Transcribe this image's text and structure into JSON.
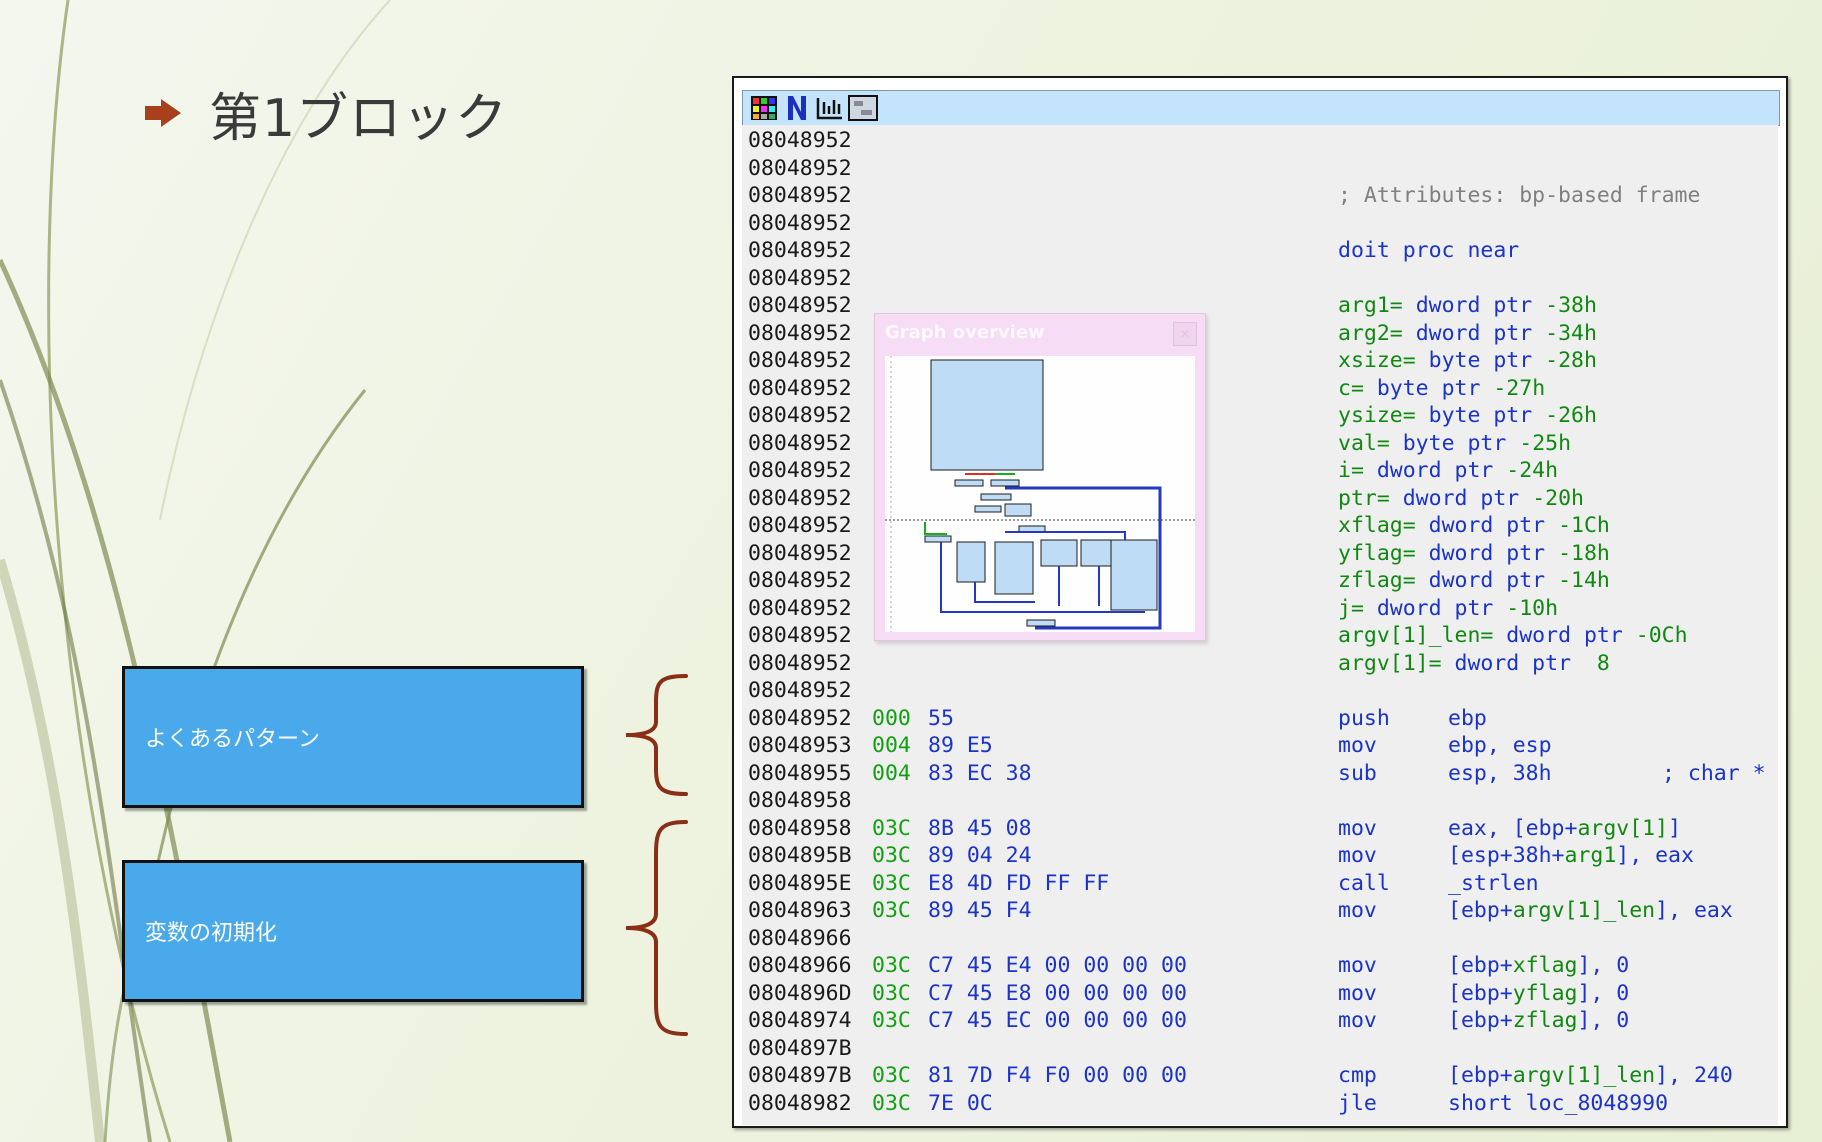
{
  "slide": {
    "title": "第1ブロック",
    "callouts": [
      {
        "label": "よくあるパターン"
      },
      {
        "label": "変数の初期化"
      }
    ]
  },
  "ida": {
    "toolbar_icons": [
      "graph-grid-icon",
      "names-n-icon",
      "strings-icon",
      "segments-icon"
    ],
    "graph_overview": {
      "title": "Graph overview"
    },
    "lines": [
      {
        "addr": "08048952"
      },
      {
        "addr": "08048952"
      },
      {
        "addr": "08048952",
        "comment": "; Attributes: bp-based frame"
      },
      {
        "addr": "08048952"
      },
      {
        "addr": "08048952",
        "proc": "doit proc near"
      },
      {
        "addr": "08048952"
      },
      {
        "addr": "08048952",
        "name": "arg1=",
        "type": "dword ptr",
        "off": "-38h"
      },
      {
        "addr": "08048952",
        "name": "arg2=",
        "type": "dword ptr",
        "off": "-34h"
      },
      {
        "addr": "08048952",
        "name": "xsize=",
        "type": "byte ptr",
        "off": "-28h"
      },
      {
        "addr": "08048952",
        "name": "c=",
        "type": "byte ptr",
        "off": "-27h"
      },
      {
        "addr": "08048952",
        "name": "ysize=",
        "type": "byte ptr",
        "off": "-26h"
      },
      {
        "addr": "08048952",
        "name": "val=",
        "type": "byte ptr",
        "off": "-25h"
      },
      {
        "addr": "08048952",
        "name": "i=",
        "type": "dword ptr",
        "off": "-24h"
      },
      {
        "addr": "08048952",
        "name": "ptr=",
        "type": "dword ptr",
        "off": "-20h"
      },
      {
        "addr": "08048952",
        "name": "xflag=",
        "type": "dword ptr",
        "off": "-1Ch"
      },
      {
        "addr": "08048952",
        "name": "yflag=",
        "type": "dword ptr",
        "off": "-18h"
      },
      {
        "addr": "08048952",
        "name": "zflag=",
        "type": "dword ptr",
        "off": "-14h"
      },
      {
        "addr": "08048952",
        "name": "j=",
        "type": "dword ptr",
        "off": "-10h"
      },
      {
        "addr": "08048952",
        "name": "argv[1]_len=",
        "type": "dword ptr",
        "off": "-0Ch"
      },
      {
        "addr": "08048952",
        "name": "argv[1]=",
        "type": "dword ptr",
        "off": " 8"
      },
      {
        "addr": "08048952"
      },
      {
        "addr": "08048952",
        "sp": "000",
        "bytes": "55",
        "mnem": "push",
        "ops": "ebp"
      },
      {
        "addr": "08048953",
        "sp": "004",
        "bytes": "89 E5",
        "mnem": "mov",
        "ops": "ebp, esp"
      },
      {
        "addr": "08048955",
        "sp": "004",
        "bytes": "83 EC 38",
        "mnem": "sub",
        "ops": "esp, 38h",
        "rcomment": "; char *"
      },
      {
        "addr": "08048958"
      },
      {
        "addr": "08048958",
        "sp": "03C",
        "bytes": "8B 45 08",
        "mnem": "mov",
        "ops_pre": "eax, [ebp+",
        "ops_var": "argv[1]",
        "ops_post": "]"
      },
      {
        "addr": "0804895B",
        "sp": "03C",
        "bytes": "89 04 24",
        "mnem": "mov",
        "ops_pre": "[esp+38h+",
        "ops_var": "arg1",
        "ops_post": "], eax"
      },
      {
        "addr": "0804895E",
        "sp": "03C",
        "bytes": "E8 4D FD FF FF",
        "mnem": "call",
        "ops": "_strlen"
      },
      {
        "addr": "08048963",
        "sp": "03C",
        "bytes": "89 45 F4",
        "mnem": "mov",
        "ops_pre": "[ebp+",
        "ops_var": "argv[1]_len",
        "ops_post": "], eax"
      },
      {
        "addr": "08048966"
      },
      {
        "addr": "08048966",
        "sp": "03C",
        "bytes": "C7 45 E4 00 00 00 00",
        "mnem": "mov",
        "ops_pre": "[ebp+",
        "ops_var": "xflag",
        "ops_post": "], 0"
      },
      {
        "addr": "0804896D",
        "sp": "03C",
        "bytes": "C7 45 E8 00 00 00 00",
        "mnem": "mov",
        "ops_pre": "[ebp+",
        "ops_var": "yflag",
        "ops_post": "], 0"
      },
      {
        "addr": "08048974",
        "sp": "03C",
        "bytes": "C7 45 EC 00 00 00 00",
        "mnem": "mov",
        "ops_pre": "[ebp+",
        "ops_var": "zflag",
        "ops_post": "], 0"
      },
      {
        "addr": "0804897B"
      },
      {
        "addr": "0804897B",
        "sp": "03C",
        "bytes": "81 7D F4 F0 00 00 00",
        "mnem": "cmp",
        "ops_pre": "[ebp+",
        "ops_var": "argv[1]_len",
        "ops_post": "], 240"
      },
      {
        "addr": "08048982",
        "sp": "03C",
        "bytes": "7E 0C",
        "mnem": "jle",
        "ops": "short loc_8048990"
      }
    ]
  }
}
